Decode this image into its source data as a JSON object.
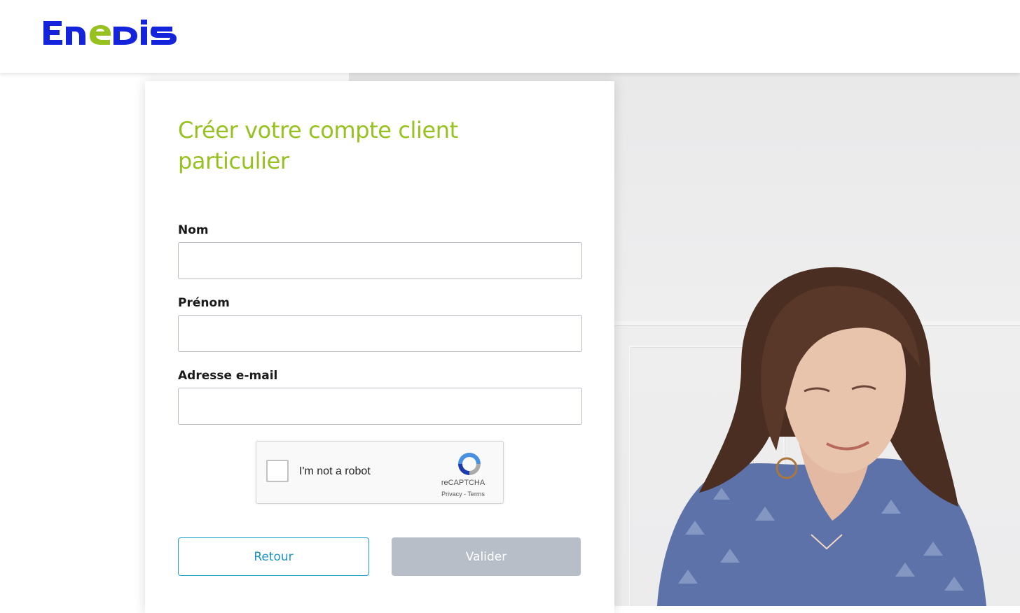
{
  "brand": {
    "name": "ENEDIS",
    "primary": "#1423dc",
    "accent": "#96c11f"
  },
  "page": {
    "title": "Créer votre compte client particulier"
  },
  "form": {
    "nom_label": "Nom",
    "nom_value": "",
    "prenom_label": "Prénom",
    "prenom_value": "",
    "email_label": "Adresse e-mail",
    "email_value": ""
  },
  "captcha": {
    "label": "I'm not a robot",
    "brand": "reCAPTCHA",
    "links": "Privacy - Terms",
    "checked": false
  },
  "actions": {
    "back_label": "Retour",
    "submit_label": "Valider",
    "submit_enabled": false
  },
  "background": {
    "icon": "woman-photo"
  }
}
